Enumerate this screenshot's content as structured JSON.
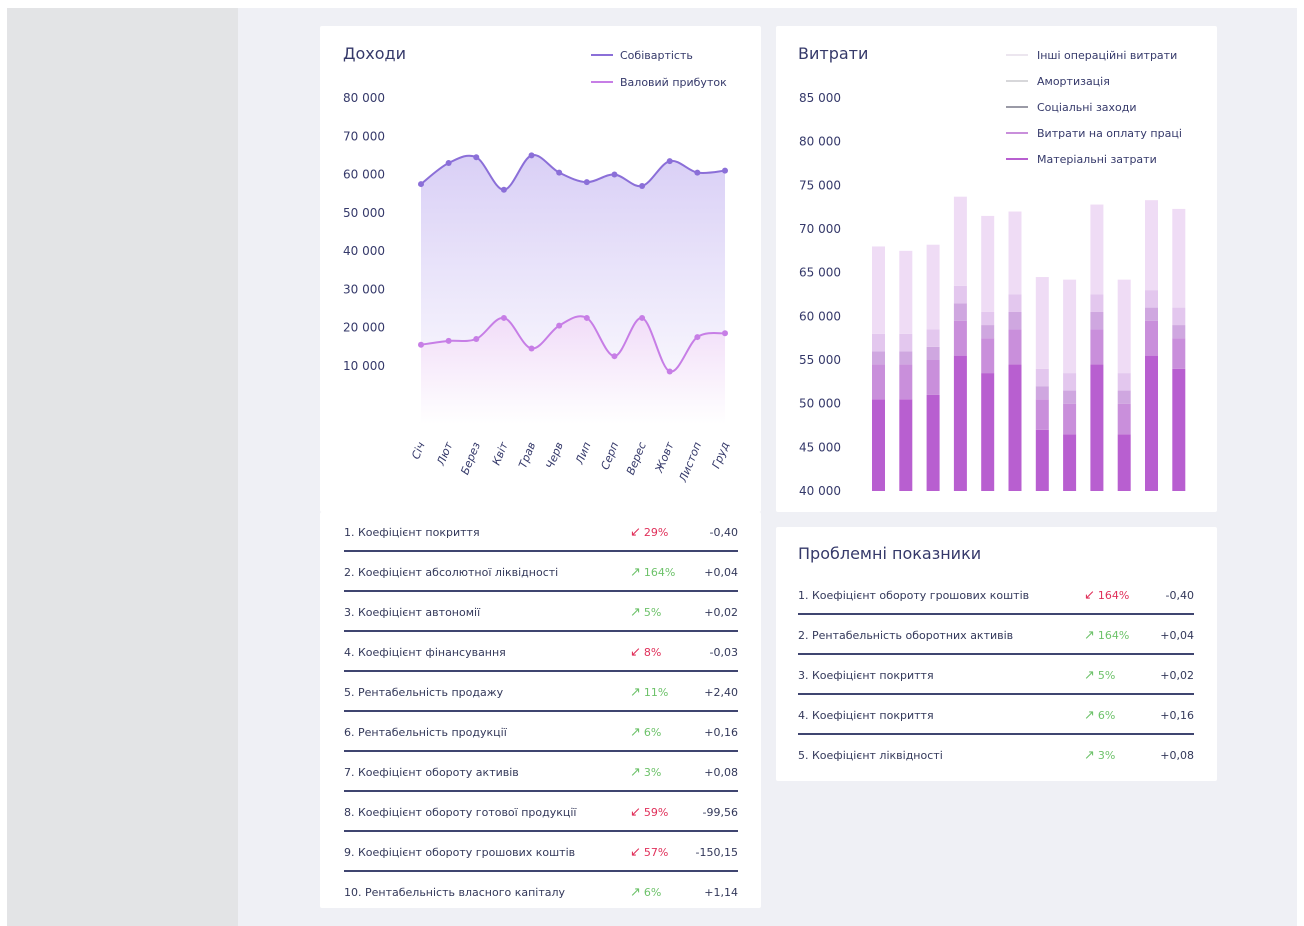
{
  "colors": {
    "line_cost": "#8b6fd8",
    "line_profit": "#c77ee6",
    "bar_colors": [
      "#b85fd0",
      "#c98fdb",
      "#cfa7e0",
      "#e3c7ee",
      "#efdcf5"
    ],
    "positive": "#6dc26a",
    "negative": "#e0305a"
  },
  "chart_data": [
    {
      "type": "line",
      "title": "Доходи",
      "categories": [
        "Січ",
        "Лют",
        "Берез",
        "Квіт",
        "Трав",
        "Черв",
        "Лип",
        "Серп",
        "Верес",
        "Жовт",
        "Листоп",
        "Груд"
      ],
      "series": [
        {
          "name": "Собівартість",
          "values": [
            57500,
            63000,
            64500,
            56000,
            65000,
            60500,
            58000,
            60000,
            57000,
            63500,
            60500,
            61000
          ]
        },
        {
          "name": "Валовий прибуток",
          "values": [
            15500,
            16500,
            17000,
            22500,
            14500,
            20500,
            22500,
            12500,
            22500,
            8500,
            17500,
            18500
          ]
        }
      ],
      "ylim": [
        0,
        80000
      ],
      "yticks": [
        "10 000",
        "20 000",
        "30 000",
        "40 000",
        "50 000",
        "60 000",
        "70 000",
        "80 000"
      ],
      "ytick_values": [
        10000,
        20000,
        30000,
        40000,
        50000,
        60000,
        70000,
        80000
      ],
      "legend_position": "top-right",
      "grid": false
    },
    {
      "type": "bar",
      "stacked": true,
      "title": "Витрати",
      "categories_count": 12,
      "series": [
        {
          "name": "Матеріальні затрати",
          "values": [
            50500,
            50500,
            51000,
            55500,
            53500,
            54500,
            47000,
            46500,
            54500,
            46500,
            55500,
            54000
          ]
        },
        {
          "name": "Витрати на оплату праці",
          "values": [
            4000,
            4000,
            4000,
            4000,
            4000,
            4000,
            3500,
            3500,
            4000,
            3500,
            4000,
            3500
          ]
        },
        {
          "name": "Соціальні заходи",
          "values": [
            1500,
            1500,
            1500,
            2000,
            1500,
            2000,
            1500,
            1500,
            2000,
            1500,
            1500,
            1500
          ]
        },
        {
          "name": "Амортизація",
          "values": [
            2000,
            2000,
            2000,
            2000,
            1500,
            2000,
            2000,
            2000,
            2000,
            2000,
            2000,
            2000
          ]
        },
        {
          "name": "Інші операційні витрати",
          "values": [
            10000,
            9500,
            9700,
            10200,
            11000,
            9500,
            10500,
            10700,
            10300,
            10700,
            10300,
            11300
          ]
        }
      ],
      "ylim": [
        40000,
        85000
      ],
      "yticks": [
        "40 000",
        "45 000",
        "50 000",
        "55 000",
        "60 000",
        "65 000",
        "70 000",
        "75 000",
        "80 000",
        "85 000"
      ],
      "ytick_values": [
        40000,
        45000,
        50000,
        55000,
        60000,
        65000,
        70000,
        75000,
        80000,
        85000
      ],
      "legend_position": "top-right",
      "grid": false
    }
  ],
  "left_indicators": [
    {
      "name": "1. Коефіцієнт покриття",
      "trend": "down",
      "percent": "29%",
      "value": "-0,40"
    },
    {
      "name": "2. Коефіцієнт абсолютної ліквідності",
      "trend": "up",
      "percent": "164%",
      "value": "+0,04"
    },
    {
      "name": "3. Коефіцієнт автономії",
      "trend": "up",
      "percent": "5%",
      "value": "+0,02"
    },
    {
      "name": "4. Коефіцієнт фінансування",
      "trend": "down",
      "percent": "8%",
      "value": "-0,03"
    },
    {
      "name": "5. Рентабельність продажу",
      "trend": "up",
      "percent": "11%",
      "value": "+2,40"
    },
    {
      "name": "6. Рентабельність продукції",
      "trend": "up",
      "percent": "6%",
      "value": "+0,16"
    },
    {
      "name": "7. Коефіцієнт обороту активів",
      "trend": "up",
      "percent": "3%",
      "value": "+0,08"
    },
    {
      "name": "8. Коефіцієнт обороту готової продукції",
      "trend": "down",
      "percent": "59%",
      "value": "-99,56"
    },
    {
      "name": "9. Коефіцієнт обороту грошових коштів",
      "trend": "down",
      "percent": "57%",
      "value": "-150,15"
    },
    {
      "name": "10. Рентабельність власного капіталу",
      "trend": "up",
      "percent": "6%",
      "value": "+1,14"
    }
  ],
  "problem_panel": {
    "title": "Проблемні показники",
    "items": [
      {
        "name": "1. Коефіцієнт обороту грошових коштів",
        "trend": "down",
        "percent": "164%",
        "value": "-0,40"
      },
      {
        "name": "2. Рентабельність оборотних активів",
        "trend": "up",
        "percent": "164%",
        "value": "+0,04"
      },
      {
        "name": "3. Коефіцієнт покриття",
        "trend": "up",
        "percent": "5%",
        "value": "+0,02"
      },
      {
        "name": "4. Коефіцієнт покриття",
        "trend": "up",
        "percent": "6%",
        "value": "+0,16"
      },
      {
        "name": "5. Коефіцієнт ліквідності",
        "trend": "up",
        "percent": "3%",
        "value": "+0,08"
      }
    ]
  },
  "arrows": {
    "up": "↗",
    "down": "↙"
  }
}
